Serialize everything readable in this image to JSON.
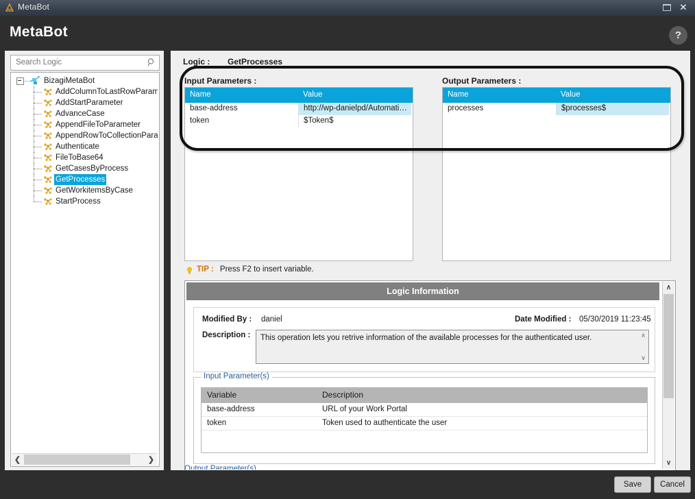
{
  "window": {
    "title": "MetaBot",
    "icon": "metabot-app-icon",
    "minimize": "minimize-icon",
    "close": "close-icon"
  },
  "header": {
    "title": "MetaBot",
    "help_label": "?"
  },
  "sidebar": {
    "search": {
      "placeholder": "Search Logic",
      "value": "",
      "icon": "search-icon"
    },
    "root": "BizagiMetaBot",
    "items": [
      {
        "label": "AddColumnToLastRowParameter",
        "selected": false
      },
      {
        "label": "AddStartParameter",
        "selected": false
      },
      {
        "label": "AdvanceCase",
        "selected": false
      },
      {
        "label": "AppendFileToParameter",
        "selected": false
      },
      {
        "label": "AppendRowToCollectionParameter",
        "selected": false
      },
      {
        "label": "Authenticate",
        "selected": false
      },
      {
        "label": "FileToBase64",
        "selected": false
      },
      {
        "label": "GetCasesByProcess",
        "selected": false
      },
      {
        "label": "GetProcesses",
        "selected": true
      },
      {
        "label": "GetWorkitemsByCase",
        "selected": false
      },
      {
        "label": "StartProcess",
        "selected": false
      }
    ],
    "hscroll": {
      "left_arrow": "❮",
      "right_arrow": "❯"
    }
  },
  "main": {
    "logic_label": "Logic :",
    "logic_name": "GetProcesses",
    "input_params": {
      "title": "Input Parameters :",
      "columns": [
        "Name",
        "Value"
      ],
      "rows": [
        {
          "name": "base-address",
          "value": "http://wp-danielpd/Automation...",
          "highlighted": true
        },
        {
          "name": "token",
          "value": "$Token$",
          "highlighted": false
        }
      ]
    },
    "output_params": {
      "title": "Output Parameters :",
      "columns": [
        "Name",
        "Value"
      ],
      "rows": [
        {
          "name": "processes",
          "value": "$processes$",
          "highlighted": true
        }
      ]
    },
    "tip": {
      "icon": "lightbulb-icon",
      "label": "TIP :",
      "text": "Press F2 to insert variable."
    },
    "logic_information": {
      "title": "Logic Information",
      "modified_by_label": "Modified By :",
      "modified_by_value": "daniel",
      "date_modified_label": "Date Modified :",
      "date_modified_value": "05/30/2019 11:23:45",
      "description_label": "Description :",
      "description_value": "This operation lets you retrive information of the available processes for the authenticated user.",
      "input_parameters_legend": "Input Parameter(s)",
      "output_parameters_legend": "Output Parameter(s)",
      "table_columns": [
        "Variable",
        "Description"
      ],
      "table_rows": [
        {
          "variable": "base-address",
          "description": "URL of your Work Portal"
        },
        {
          "variable": "token",
          "description": "Token used to authenticate the user"
        }
      ],
      "scroll_up": "∧",
      "scroll_down": "∨"
    }
  },
  "footer": {
    "save_label": "Save",
    "cancel_label": "Cancel"
  },
  "colors": {
    "accent_cyan": "#0aa4db",
    "highlight_row": "#c9e9f5",
    "panel_bg": "#efefef",
    "chrome_dark": "#2e2e2e",
    "header_gray": "#808080",
    "tip_orange": "#d4720b",
    "legend_blue": "#2a6099"
  }
}
